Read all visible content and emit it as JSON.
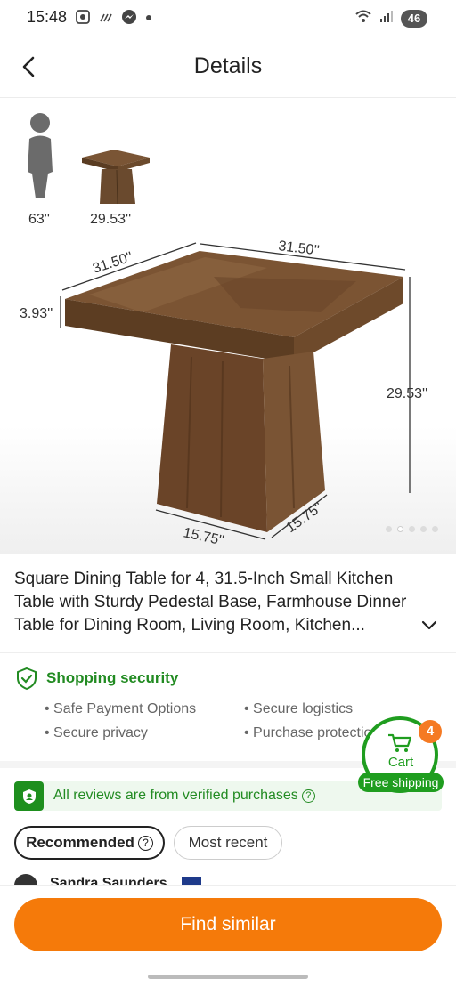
{
  "status_bar": {
    "time": "15:48",
    "battery": "46"
  },
  "header": {
    "title": "Details"
  },
  "gallery": {
    "dims": {
      "person_height": "63''",
      "table_height_small": "29.53''",
      "top_left": "31.50''",
      "top_right": "31.50''",
      "thickness": "3.93''",
      "height": "29.53''",
      "base_left": "15.75''",
      "base_right": "15.75''"
    },
    "dot_count": 5,
    "active_dot": 2
  },
  "product": {
    "title": "Square Dining Table for 4, 31.5-Inch Small Kitchen Table with Sturdy Pedestal Base, Farmhouse Dinner Table for Dining Room, Living Room, Kitchen..."
  },
  "security": {
    "title": "Shopping security",
    "items": [
      "Safe Payment Options",
      "Secure logistics",
      "Secure privacy",
      "Purchase protection"
    ]
  },
  "cart": {
    "label": "Cart",
    "count": "4",
    "free_shipping": "Free shipping"
  },
  "reviews": {
    "verified_text": "All reviews are from verified purchases",
    "sort_recommended": "Recommended",
    "sort_recent": "Most recent",
    "first_reviewer": "Sandra Saunders"
  },
  "colors": {
    "accent": "#f57a0a",
    "green": "#1f9d1f"
  },
  "cta": {
    "find_similar": "Find similar"
  }
}
